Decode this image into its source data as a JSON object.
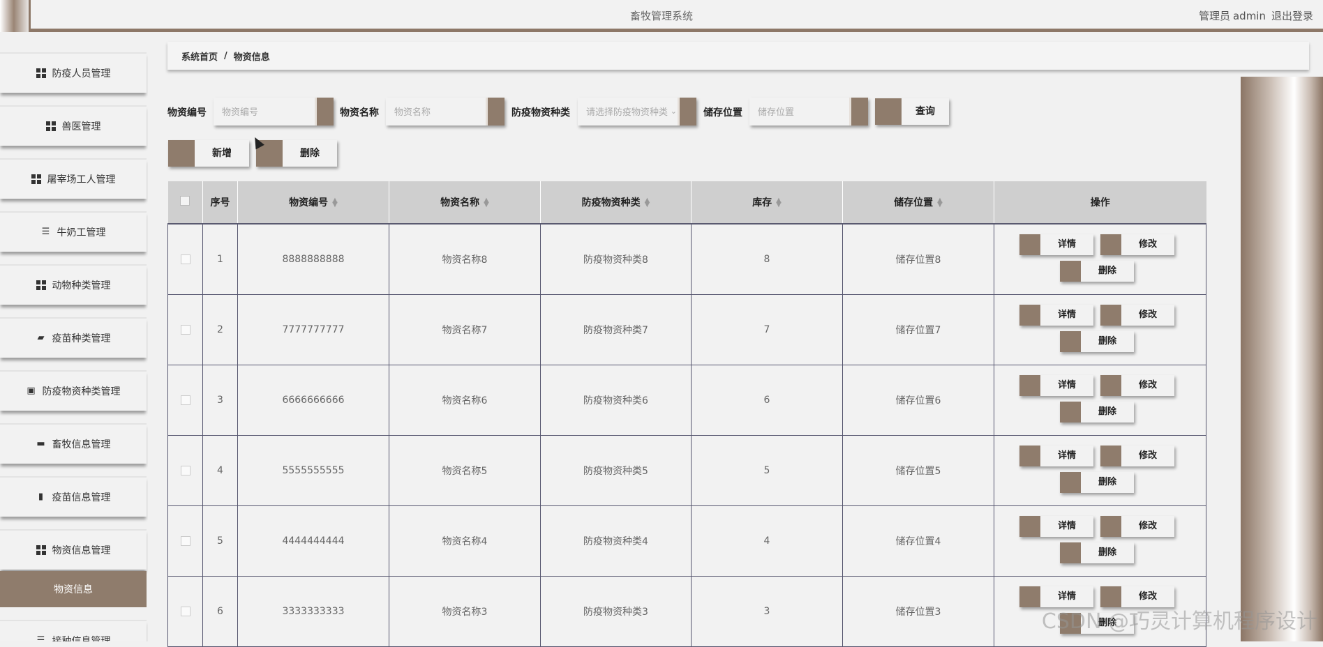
{
  "header": {
    "title": "畜牧管理系统",
    "role": "管理员",
    "username": "admin",
    "logout": "退出登录"
  },
  "sidebar": {
    "items": [
      {
        "label": "防疫人员管理",
        "icon": "grid-icon"
      },
      {
        "label": "兽医管理",
        "icon": "grid-icon"
      },
      {
        "label": "屠宰场工人管理",
        "icon": "grid-icon"
      },
      {
        "label": "牛奶工管理",
        "icon": "list-icon"
      },
      {
        "label": "动物种类管理",
        "icon": "grid-icon"
      },
      {
        "label": "疫苗种类管理",
        "icon": "wallet-icon"
      },
      {
        "label": "防疫物资种类管理",
        "icon": "clipboard-icon"
      },
      {
        "label": "畜牧信息管理",
        "icon": "ticket-icon"
      },
      {
        "label": "疫苗信息管理",
        "icon": "bar-chart-icon"
      },
      {
        "label": "物资信息管理",
        "icon": "grid-icon"
      }
    ],
    "active_sub": "物资信息",
    "last_partial": "接种信息管理"
  },
  "breadcrumb": {
    "home": "系统首页",
    "separator": "/",
    "current": "物资信息"
  },
  "search": {
    "code_label": "物资编号",
    "code_placeholder": "物资编号",
    "name_label": "物资名称",
    "name_placeholder": "物资名称",
    "type_label": "防疫物资种类",
    "type_placeholder": "请选择防疫物资种类",
    "location_label": "储存位置",
    "location_placeholder": "储存位置",
    "query_button": "查询"
  },
  "actions": {
    "add": "新增",
    "delete": "删除"
  },
  "table": {
    "headers": {
      "index": "序号",
      "code": "物资编号",
      "name": "物资名称",
      "type": "防疫物资种类",
      "stock": "库存",
      "location": "储存位置",
      "ops": "操作"
    },
    "row_buttons": {
      "detail": "详情",
      "edit": "修改",
      "delete": "删除"
    },
    "rows": [
      {
        "index": "1",
        "code": "8888888888",
        "name": "物资名称8",
        "type": "防疫物资种类8",
        "stock": "8",
        "location": "储存位置8"
      },
      {
        "index": "2",
        "code": "7777777777",
        "name": "物资名称7",
        "type": "防疫物资种类7",
        "stock": "7",
        "location": "储存位置7"
      },
      {
        "index": "3",
        "code": "6666666666",
        "name": "物资名称6",
        "type": "防疫物资种类6",
        "stock": "6",
        "location": "储存位置6"
      },
      {
        "index": "4",
        "code": "5555555555",
        "name": "物资名称5",
        "type": "防疫物资种类5",
        "stock": "5",
        "location": "储存位置5"
      },
      {
        "index": "5",
        "code": "4444444444",
        "name": "物资名称4",
        "type": "防疫物资种类4",
        "stock": "4",
        "location": "储存位置4"
      },
      {
        "index": "6",
        "code": "3333333333",
        "name": "物资名称3",
        "type": "防疫物资种类3",
        "stock": "3",
        "location": "储存位置3"
      }
    ]
  },
  "watermark": "CSDN @巧灵计算机程序设计",
  "colors": {
    "accent": "#8f7c6c",
    "background": "#f1f1f1",
    "table_header": "#cfcfcf",
    "grid_line": "#55556e"
  }
}
